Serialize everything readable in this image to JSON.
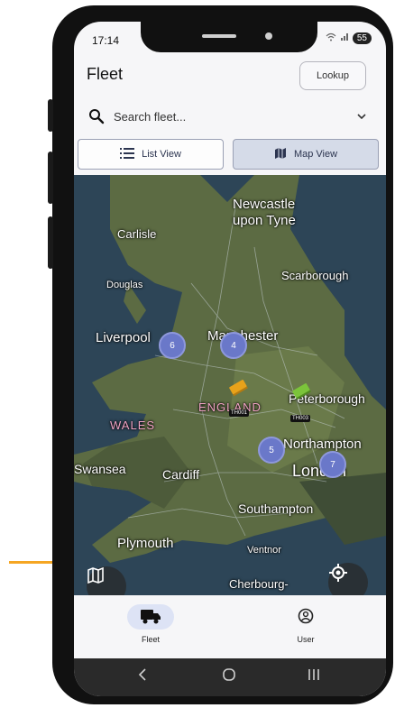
{
  "status_bar": {
    "time": "17:14",
    "battery": "55"
  },
  "header": {
    "title": "Fleet",
    "lookup_label": "Lookup"
  },
  "search": {
    "placeholder": "Search fleet..."
  },
  "view_toggle": {
    "list_label": "List View",
    "map_label": "Map View",
    "selected": "Map View"
  },
  "map": {
    "places": [
      {
        "id": "newcastle",
        "name": "Newcastle upon Tyne"
      },
      {
        "id": "carlisle",
        "name": "Carlisle"
      },
      {
        "id": "scarborough",
        "name": "Scarborough"
      },
      {
        "id": "douglas",
        "name": "Douglas"
      },
      {
        "id": "liverpool",
        "name": "Liverpool"
      },
      {
        "id": "manchester",
        "name": "Manchester"
      },
      {
        "id": "england",
        "name": "ENGLAND"
      },
      {
        "id": "peterborough",
        "name": "Peterborough"
      },
      {
        "id": "wales",
        "name": "WALES"
      },
      {
        "id": "swansea",
        "name": "Swansea"
      },
      {
        "id": "cardiff",
        "name": "Cardiff"
      },
      {
        "id": "northampton",
        "name": "Northampton"
      },
      {
        "id": "london",
        "name": "London"
      },
      {
        "id": "southampton",
        "name": "Southampton"
      },
      {
        "id": "plymouth",
        "name": "Plymouth"
      },
      {
        "id": "ventnor",
        "name": "Ventnor"
      },
      {
        "id": "cherbourg",
        "name": "Cherbourg-"
      }
    ],
    "clusters": [
      {
        "id": "liverpool",
        "count": "6"
      },
      {
        "id": "manchester",
        "count": "4"
      },
      {
        "id": "midlands",
        "count": "5"
      },
      {
        "id": "london",
        "count": "7"
      }
    ],
    "trucks": [
      {
        "id": "TH001",
        "label": "TH001",
        "color": "#e8a21a"
      },
      {
        "id": "TH003",
        "label": "TH003",
        "color": "#7bc43a"
      }
    ]
  },
  "bottom_nav": {
    "items": [
      {
        "label": "Fleet",
        "icon": "truck-icon",
        "active": true
      },
      {
        "label": "User",
        "icon": "user-icon",
        "active": false
      }
    ]
  },
  "annotation": {
    "arrow_color": "#f5a623",
    "target": "map-layers-button"
  },
  "colors": {
    "accent": "#6a78c9",
    "toggle_selected_bg": "#d5dbe8",
    "nav_active_bg": "#dde3f5"
  }
}
